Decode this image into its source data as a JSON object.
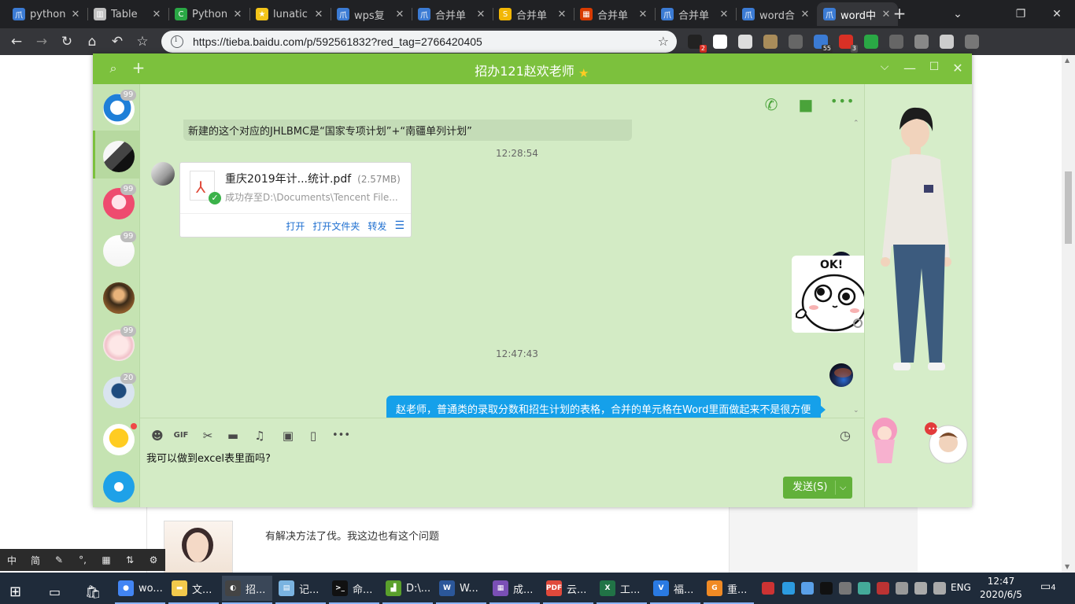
{
  "browser": {
    "tabs": [
      {
        "title": "python",
        "fav": "#3b7bd4",
        "glyph": "爪"
      },
      {
        "title": "Table",
        "fav": "#c0c0c0",
        "glyph": "▥"
      },
      {
        "title": "Python",
        "fav": "#2aa845",
        "glyph": "C"
      },
      {
        "title": "lunatic",
        "fav": "#f3c419",
        "glyph": "★"
      },
      {
        "title": "wps复",
        "fav": "#3b7bd4",
        "glyph": "爪"
      },
      {
        "title": "合并单",
        "fav": "#3b7bd4",
        "glyph": "爪"
      },
      {
        "title": "合并单",
        "fav": "#f2b705",
        "glyph": "S"
      },
      {
        "title": "合并单",
        "fav": "#d83b01",
        "glyph": "▦"
      },
      {
        "title": "合并单",
        "fav": "#3b7bd4",
        "glyph": "爪"
      },
      {
        "title": "word合",
        "fav": "#3b7bd4",
        "glyph": "爪"
      },
      {
        "title": "word中",
        "fav": "#3b7bd4",
        "glyph": "爪"
      }
    ],
    "url": "https://tieba.baidu.com/p/592561832?red_tag=2766420405",
    "extensions": [
      {
        "color": "#222",
        "badge": "2",
        "badge_color": "#d93025"
      },
      {
        "color": "#fff",
        "badge": "",
        "badge_color": ""
      },
      {
        "color": "#ddd",
        "badge": "",
        "badge_color": ""
      },
      {
        "color": "#a98c5a",
        "badge": "",
        "badge_color": ""
      },
      {
        "color": "#666",
        "badge": "",
        "badge_color": ""
      },
      {
        "color": "#3b7bd4",
        "badge": "55",
        "badge_color": "#333"
      },
      {
        "color": "#d93025",
        "badge": "3",
        "badge_color": "#555"
      },
      {
        "color": "#2aa845",
        "badge": "",
        "badge_color": ""
      },
      {
        "color": "#666",
        "badge": "",
        "badge_color": ""
      },
      {
        "color": "#888",
        "badge": "",
        "badge_color": ""
      },
      {
        "color": "#ccc",
        "badge": "",
        "badge_color": ""
      },
      {
        "color": "#777",
        "badge": "",
        "badge_color": ""
      }
    ]
  },
  "page": {
    "post_text": "有解决方法了伐。我这边也有这个问题"
  },
  "ime": {
    "items": [
      "中",
      "简",
      "✎",
      "°,",
      "▦",
      "⇅",
      "⚙"
    ]
  },
  "qq": {
    "title": "招办121赵欢老师",
    "contacts": [
      {
        "badge": "99"
      },
      {
        "badge": ""
      },
      {
        "badge": "99"
      },
      {
        "badge": "99"
      },
      {
        "badge": ""
      },
      {
        "badge": "99"
      },
      {
        "badge": "20"
      },
      {
        "badge": ""
      },
      {
        "badge": ""
      }
    ],
    "messages": {
      "old_text": "新建的这个对应的JHLBMC是“国家专项计划”+“南疆单列计划”",
      "time1": "12:28:54",
      "file_name": "重庆2019年计...统计.pdf",
      "file_size": "(2.57MB)",
      "file_path": "成功存至D:\\Documents\\Tencent File...",
      "file_actions": [
        "打开",
        "打开文件夹",
        "转发"
      ],
      "sticker_text": "OK!",
      "time2": "12:47:43",
      "my_text": "赵老师，普通类的录取分数和招生计划的表格，合并的单元格在Word里面做起来不是很方便"
    },
    "input_text": "我可以做到excel表里面吗?",
    "send_label": "发送(S)"
  },
  "taskbar": {
    "items": [
      {
        "label": "wo...",
        "color": "#4285f4",
        "glyph": "●"
      },
      {
        "label": "文...",
        "color": "#f2c94c",
        "glyph": "▬"
      },
      {
        "label": "招...",
        "color": "#444",
        "glyph": "◐"
      },
      {
        "label": "记...",
        "color": "#7ab3e0",
        "glyph": "▤"
      },
      {
        "label": "命...",
        "color": "#111",
        "glyph": ">_"
      },
      {
        "label": "D:\\...",
        "color": "#5aa02c",
        "glyph": "▟"
      },
      {
        "label": "W...",
        "color": "#2b579a",
        "glyph": "W"
      },
      {
        "label": "成...",
        "color": "#7a4fb5",
        "glyph": "▦"
      },
      {
        "label": "云...",
        "color": "#e0493b",
        "glyph": "PDF"
      },
      {
        "label": "工...",
        "color": "#217346",
        "glyph": "X"
      },
      {
        "label": "福...",
        "color": "#2a7ae2",
        "glyph": "V"
      },
      {
        "label": "重...",
        "color": "#f08a24",
        "glyph": "G"
      }
    ],
    "lang": "ENG",
    "time": "12:47",
    "date": "2020/6/5",
    "notifications": "4"
  }
}
